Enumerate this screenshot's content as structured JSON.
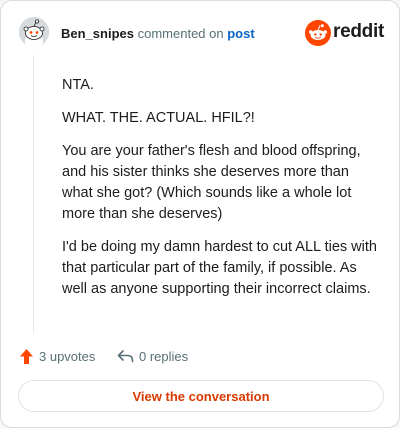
{
  "header": {
    "username": "Ben_snipes",
    "action_text": "commented on",
    "post_link": "post",
    "brand": "reddit"
  },
  "comment": {
    "paragraphs": [
      "NTA.",
      "WHAT. THE. ACTUAL. HFIL?!",
      "You are your father's flesh and blood offspring, and his sister thinks she deserves more than what she got? (Which sounds like a whole lot more than she deserves)",
      "I'd be doing my damn hardest to cut ALL ties with that particular part of the family, if possible. As well as anyone supporting their incorrect claims."
    ]
  },
  "actions": {
    "upvotes": "3 upvotes",
    "replies": "0 replies"
  },
  "cta": {
    "label": "View the conversation"
  },
  "colors": {
    "brand": "#ff4500",
    "link": "#0b63c7",
    "cta_text": "#d93a00",
    "upvote": "#ff4500"
  },
  "icons": {
    "avatar": "snoo-avatar",
    "logo": "reddit-snoo-logo",
    "upvote": "upvote-arrow-icon",
    "reply": "reply-arrow-icon"
  }
}
